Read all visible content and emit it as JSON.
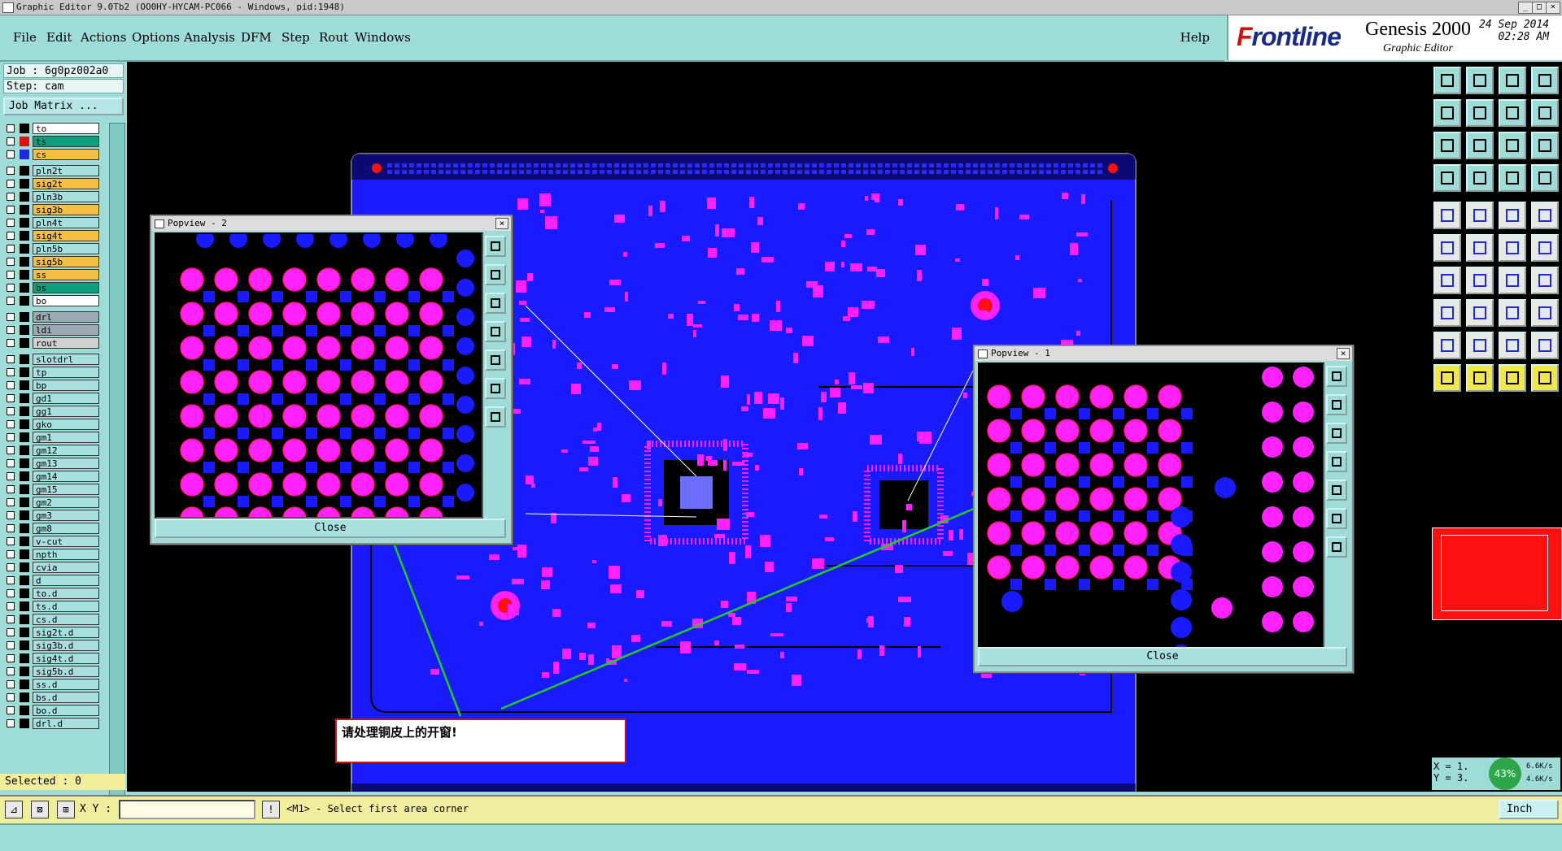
{
  "window": {
    "title": "Graphic Editor 9.0Tb2 (OO0HY-HYCAM-PC066 - Windows, pid:1948)",
    "min": "_",
    "max": "□",
    "close": "×"
  },
  "menu": {
    "items": [
      "File",
      "Edit",
      "Actions",
      "Options",
      "Analysis",
      "DFM",
      "Step",
      "Rout",
      "Windows"
    ],
    "help": "Help"
  },
  "brand": {
    "logo_prefix": "F",
    "logo_rest": "rontline",
    "product": "Genesis 2000",
    "subtitle": "Graphic Editor",
    "date": "24 Sep 2014",
    "time": "02:28 AM"
  },
  "job": {
    "job_line": "Job : 6g0pz002a0",
    "step_line": "Step: cam",
    "matrix_button": "Job Matrix ..."
  },
  "layers": [
    {
      "name": "to",
      "bg": "#ffffff",
      "swatch": "#000000"
    },
    {
      "name": "ts",
      "bg": "#0aa07a",
      "swatch": "#e01010"
    },
    {
      "name": "cs",
      "bg": "#f6c142",
      "swatch": "#1a2be0"
    },
    {
      "name": "pln2t",
      "bg": "#a7e0dd",
      "swatch": "#000000"
    },
    {
      "name": "sig2t",
      "bg": "#f6c142",
      "swatch": "#000000"
    },
    {
      "name": "pln3b",
      "bg": "#a7e0dd",
      "swatch": "#000000"
    },
    {
      "name": "sig3b",
      "bg": "#f6c142",
      "swatch": "#000000"
    },
    {
      "name": "pln4t",
      "bg": "#a7e0dd",
      "swatch": "#000000"
    },
    {
      "name": "sig4t",
      "bg": "#f6c142",
      "swatch": "#000000"
    },
    {
      "name": "pln5b",
      "bg": "#a7e0dd",
      "swatch": "#000000"
    },
    {
      "name": "sig5b",
      "bg": "#f6c142",
      "swatch": "#000000"
    },
    {
      "name": "ss",
      "bg": "#f6c142",
      "swatch": "#000000"
    },
    {
      "name": "bs",
      "bg": "#0aa07a",
      "swatch": "#000000"
    },
    {
      "name": "bo",
      "bg": "#ffffff",
      "swatch": "#000000"
    },
    {
      "name": "drl",
      "bg": "#9aaab0",
      "swatch": "#000000"
    },
    {
      "name": "ldi",
      "bg": "#9aaab0",
      "swatch": "#000000"
    },
    {
      "name": "rout",
      "bg": "#d0d0d0",
      "swatch": "#000000"
    },
    {
      "name": "slotdrl",
      "bg": "#a7e0dd",
      "swatch": "#000000"
    },
    {
      "name": "tp",
      "bg": "#a7e0dd",
      "swatch": "#000000"
    },
    {
      "name": "bp",
      "bg": "#a7e0dd",
      "swatch": "#000000"
    },
    {
      "name": "gd1",
      "bg": "#a7e0dd",
      "swatch": "#000000"
    },
    {
      "name": "gg1",
      "bg": "#a7e0dd",
      "swatch": "#000000"
    },
    {
      "name": "gko",
      "bg": "#a7e0dd",
      "swatch": "#000000"
    },
    {
      "name": "gm1",
      "bg": "#a7e0dd",
      "swatch": "#000000"
    },
    {
      "name": "gm12",
      "bg": "#a7e0dd",
      "swatch": "#000000"
    },
    {
      "name": "gm13",
      "bg": "#a7e0dd",
      "swatch": "#000000"
    },
    {
      "name": "gm14",
      "bg": "#a7e0dd",
      "swatch": "#000000"
    },
    {
      "name": "gm15",
      "bg": "#a7e0dd",
      "swatch": "#000000"
    },
    {
      "name": "gm2",
      "bg": "#a7e0dd",
      "swatch": "#000000"
    },
    {
      "name": "gm3",
      "bg": "#a7e0dd",
      "swatch": "#000000"
    },
    {
      "name": "gm8",
      "bg": "#a7e0dd",
      "swatch": "#000000"
    },
    {
      "name": "v-cut",
      "bg": "#a7e0dd",
      "swatch": "#000000"
    },
    {
      "name": "npth",
      "bg": "#a7e0dd",
      "swatch": "#000000"
    },
    {
      "name": "cvia",
      "bg": "#a7e0dd",
      "swatch": "#000000"
    },
    {
      "name": "d",
      "bg": "#a7e0dd",
      "swatch": "#000000"
    },
    {
      "name": "to.d",
      "bg": "#a7e0dd",
      "swatch": "#000000"
    },
    {
      "name": "ts.d",
      "bg": "#a7e0dd",
      "swatch": "#000000"
    },
    {
      "name": "cs.d",
      "bg": "#a7e0dd",
      "swatch": "#000000"
    },
    {
      "name": "sig2t.d",
      "bg": "#a7e0dd",
      "swatch": "#000000"
    },
    {
      "name": "sig3b.d",
      "bg": "#a7e0dd",
      "swatch": "#000000"
    },
    {
      "name": "sig4t.d",
      "bg": "#a7e0dd",
      "swatch": "#000000"
    },
    {
      "name": "sig5b.d",
      "bg": "#a7e0dd",
      "swatch": "#000000"
    },
    {
      "name": "ss.d",
      "bg": "#a7e0dd",
      "swatch": "#000000"
    },
    {
      "name": "bs.d",
      "bg": "#a7e0dd",
      "swatch": "#000000"
    },
    {
      "name": "bo.d",
      "bg": "#a7e0dd",
      "swatch": "#000000"
    },
    {
      "name": "drl.d",
      "bg": "#a7e0dd",
      "swatch": "#000000"
    }
  ],
  "selected": "Selected : 0",
  "popview2": {
    "title": "Popview - 2",
    "close": "Close"
  },
  "popview1": {
    "title": "Popview - 1",
    "close": "Close"
  },
  "annotation": "请处理铜皮上的开窗!",
  "coords": {
    "x": "X = 1.",
    "y": "Y = 3.",
    "zoom": "43%",
    "up": "6.6K/s",
    "down": "4.6K/s"
  },
  "command": {
    "xy_label": "X Y :",
    "prompt": "<M1> - Select first area corner",
    "unit": "Inch"
  },
  "colors": {
    "board": "#1a1aff",
    "pad": "#ff22ff",
    "teal": "#9fdcd8"
  }
}
